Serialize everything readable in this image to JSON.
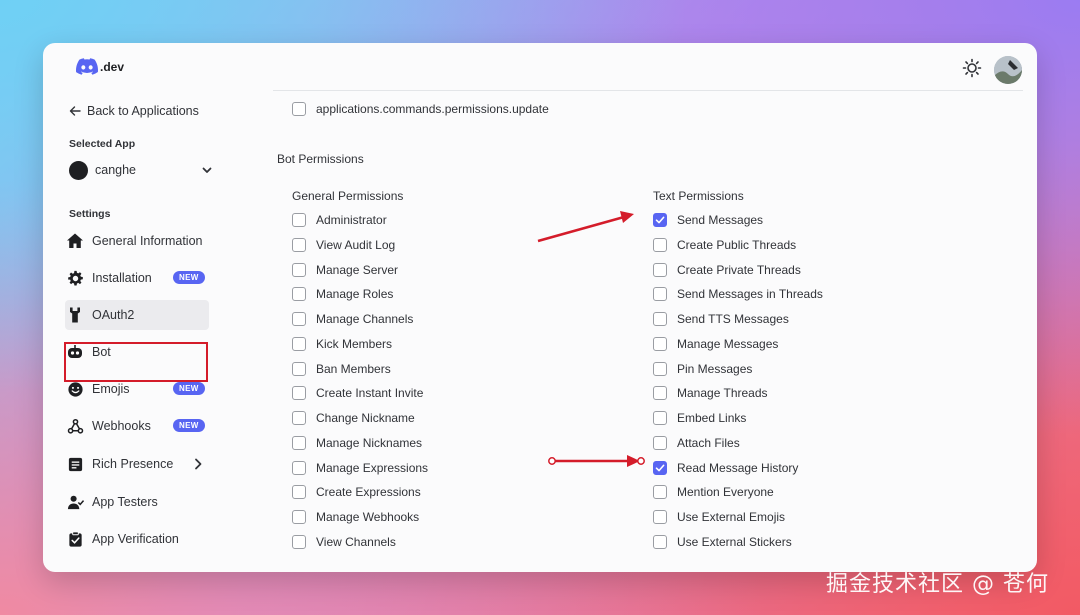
{
  "logo": {
    "text": ".dev"
  },
  "sidebar": {
    "back_label": "Back to Applications",
    "selected_app_label": "Selected App",
    "selected_app_name": "canghe",
    "settings_label": "Settings",
    "items": [
      {
        "label": "General Information",
        "icon": "home-icon"
      },
      {
        "label": "Installation",
        "icon": "gear-icon",
        "badge": "NEW"
      },
      {
        "label": "OAuth2",
        "icon": "wrench-icon"
      },
      {
        "label": "Bot",
        "icon": "robot-icon"
      },
      {
        "label": "Emojis",
        "icon": "smile-icon",
        "badge": "NEW"
      },
      {
        "label": "Webhooks",
        "icon": "webhook-icon",
        "badge": "NEW"
      },
      {
        "label": "Rich Presence",
        "icon": "document-icon"
      },
      {
        "label": "App Testers",
        "icon": "user-icon"
      },
      {
        "label": "App Verification",
        "icon": "clipboard-check-icon"
      }
    ]
  },
  "content": {
    "top_scope": "applications.commands.permissions.update",
    "bot_permissions_title": "Bot Permissions",
    "general_title": "General Permissions",
    "text_title": "Text Permissions",
    "general": [
      {
        "label": "Administrator",
        "checked": false
      },
      {
        "label": "View Audit Log",
        "checked": false
      },
      {
        "label": "Manage Server",
        "checked": false
      },
      {
        "label": "Manage Roles",
        "checked": false
      },
      {
        "label": "Manage Channels",
        "checked": false
      },
      {
        "label": "Kick Members",
        "checked": false
      },
      {
        "label": "Ban Members",
        "checked": false
      },
      {
        "label": "Create Instant Invite",
        "checked": false
      },
      {
        "label": "Change Nickname",
        "checked": false
      },
      {
        "label": "Manage Nicknames",
        "checked": false
      },
      {
        "label": "Manage Expressions",
        "checked": false
      },
      {
        "label": "Create Expressions",
        "checked": false
      },
      {
        "label": "Manage Webhooks",
        "checked": false
      },
      {
        "label": "View Channels",
        "checked": false
      }
    ],
    "text": [
      {
        "label": "Send Messages",
        "checked": true
      },
      {
        "label": "Create Public Threads",
        "checked": false
      },
      {
        "label": "Create Private Threads",
        "checked": false
      },
      {
        "label": "Send Messages in Threads",
        "checked": false
      },
      {
        "label": "Send TTS Messages",
        "checked": false
      },
      {
        "label": "Manage Messages",
        "checked": false
      },
      {
        "label": "Pin Messages",
        "checked": false
      },
      {
        "label": "Manage Threads",
        "checked": false
      },
      {
        "label": "Embed Links",
        "checked": false
      },
      {
        "label": "Attach Files",
        "checked": false
      },
      {
        "label": "Read Message History",
        "checked": true
      },
      {
        "label": "Mention Everyone",
        "checked": false
      },
      {
        "label": "Use External Emojis",
        "checked": false
      },
      {
        "label": "Use External Stickers",
        "checked": false
      }
    ]
  },
  "colors": {
    "accent": "#5865f2",
    "annotation_red": "#d41c2a"
  },
  "watermark": "掘金技术社区 @ 苍何"
}
